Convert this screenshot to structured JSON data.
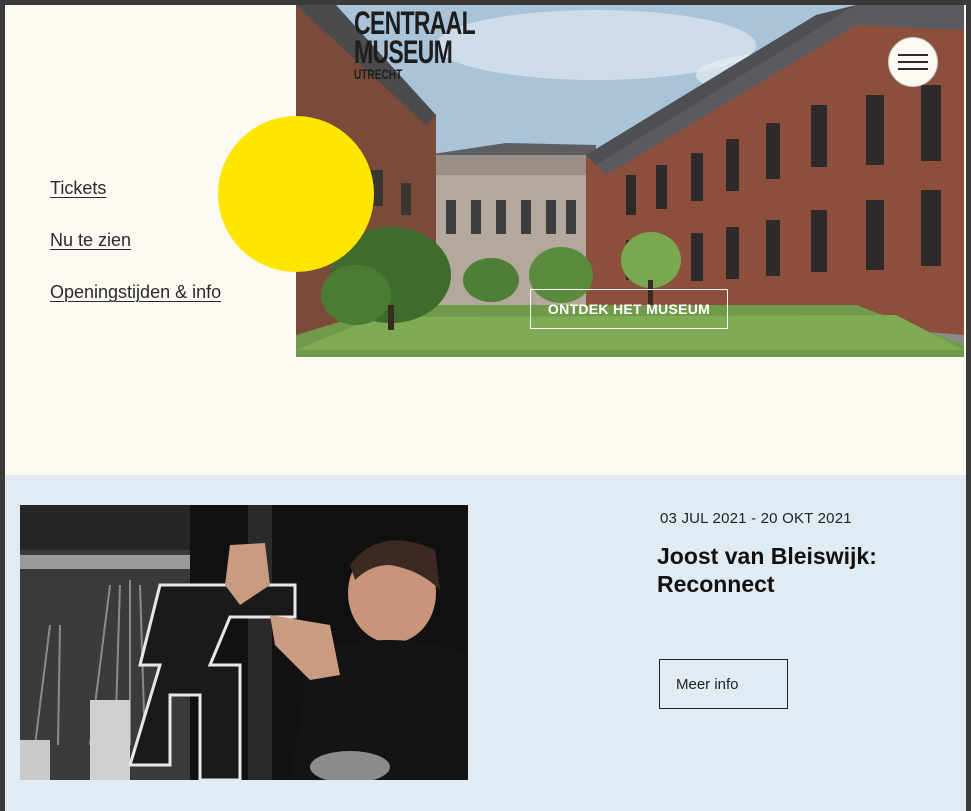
{
  "nav": {
    "links": [
      {
        "label": "Tickets"
      },
      {
        "label": "Nu te zien"
      },
      {
        "label": "Openingstijden & info"
      }
    ]
  },
  "logo": {
    "line1": "CENTRAAL",
    "line2": "MUSEUM",
    "line3": "UTRECHT"
  },
  "hero": {
    "cta_label": "ONTDEK HET MUSEUM"
  },
  "exhibition": {
    "date": "03 JUL 2021 - 20 OKT 2021",
    "title": "Joost van Bleiswijk: Reconnect",
    "button_label": "Meer info"
  },
  "colors": {
    "page_background": "#fcf9f2",
    "accent_yellow": "#ffe600",
    "exhibition_background": "#e1ebf4"
  }
}
